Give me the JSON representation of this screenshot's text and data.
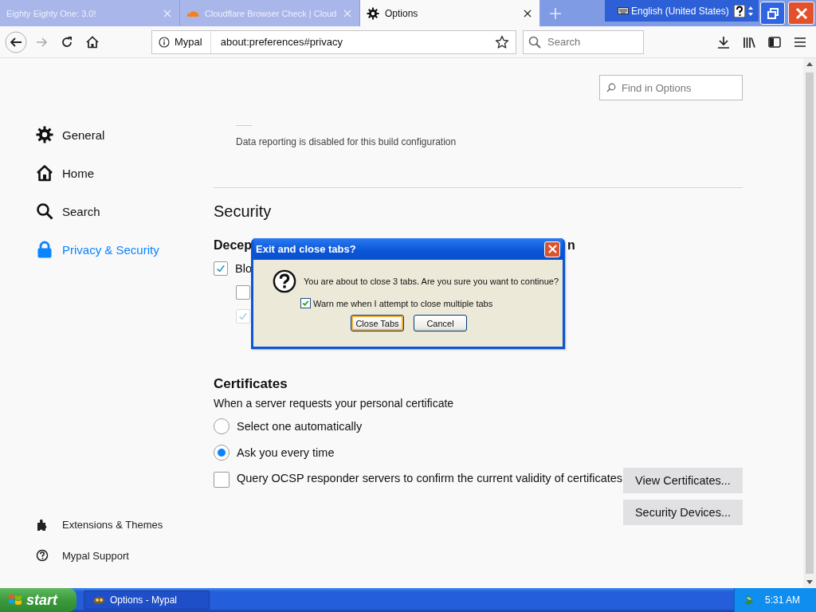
{
  "browser": {
    "tabs": [
      {
        "title": "Eighty Eighty One: 3.0!",
        "selected": false,
        "kind": "plain"
      },
      {
        "title": "Cloudflare Browser Check | Cloud",
        "selected": false,
        "kind": "cloud"
      },
      {
        "title": "Options",
        "selected": true,
        "kind": "gear"
      }
    ],
    "language_bar": {
      "label": "English (United States)"
    },
    "toolbar": {
      "identity": "Mypal",
      "url": "about:preferences#privacy",
      "search": {
        "placeholder": "Search"
      }
    }
  },
  "sidebar": {
    "items": [
      {
        "label": "General",
        "selected": false
      },
      {
        "label": "Home",
        "selected": false
      },
      {
        "label": "Search",
        "selected": false
      },
      {
        "label": "Privacy & Security",
        "selected": true
      }
    ],
    "footer_links": [
      "Extensions & Themes",
      "Mypal Support"
    ]
  },
  "preferences": {
    "find": {
      "placeholder": "Find in Options"
    },
    "data_reporting_note": "Data reporting is disabled for this build configuration",
    "security_heading": "Security",
    "deceptive": {
      "heading_start": "Decep",
      "heading_end": "n",
      "options": [
        {
          "label": "Blo",
          "checked": true,
          "disabled": false
        },
        {
          "checked": false,
          "disabled": false
        },
        {
          "checked": true,
          "disabled": true
        }
      ]
    },
    "certificates": {
      "heading": "Certificates",
      "intro": "When a server requests your personal certificate",
      "radios": [
        {
          "label": "Select one automatically",
          "selected": false
        },
        {
          "label": "Ask you every time",
          "selected": true
        }
      ],
      "ocsp": {
        "label": "Query OCSP responder servers to confirm the current validity of certificates",
        "checked": false
      },
      "buttons": [
        "View Certificates...",
        "Security Devices..."
      ]
    }
  },
  "dialog": {
    "title": "Exit and close tabs?",
    "message": "You are about to close 3 tabs. Are you sure you want to continue?",
    "warn": {
      "label": "Warn me when I attempt to close multiple tabs",
      "checked": true
    },
    "buttons": [
      {
        "label": "Close Tabs",
        "selected": true
      },
      {
        "label": "Cancel",
        "selected": false
      }
    ]
  },
  "taskbar": {
    "start": "start",
    "tasks": [
      "Options - Mypal"
    ],
    "clock": "5:31 AM"
  }
}
